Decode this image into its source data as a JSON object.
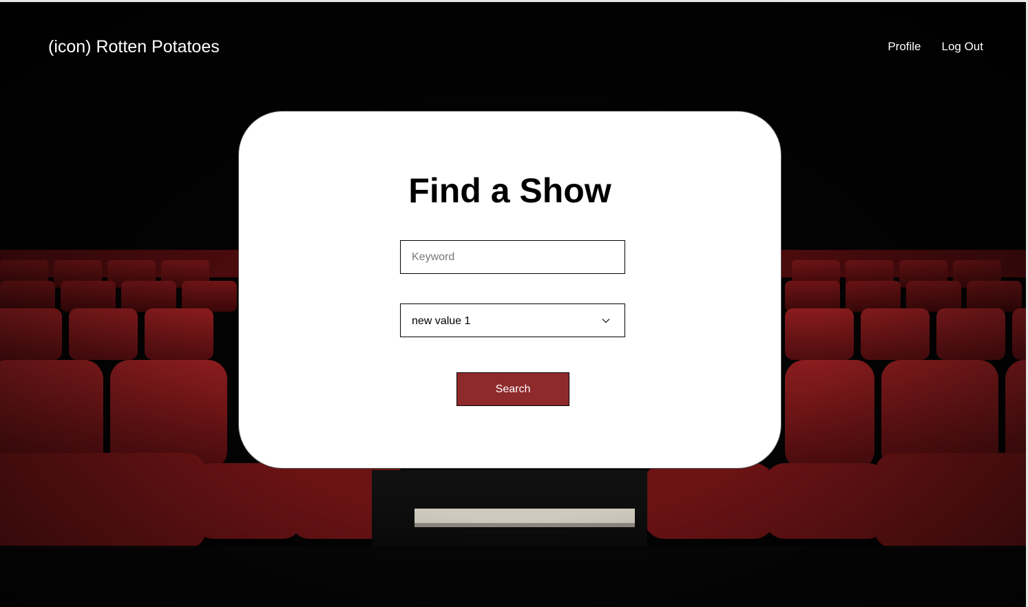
{
  "header": {
    "brand": "(icon) Rotten Potatoes",
    "nav": [
      {
        "label": "Profile"
      },
      {
        "label": "Log Out"
      }
    ]
  },
  "search_card": {
    "title": "Find a Show",
    "keyword_placeholder": "Keyword",
    "keyword_value": "",
    "select_value": "new value 1",
    "search_label": "Search"
  },
  "colors": {
    "accent": "#8f2a2b",
    "seat_red": "#7a1518"
  },
  "icons": {
    "select": "chevron-down-icon"
  }
}
